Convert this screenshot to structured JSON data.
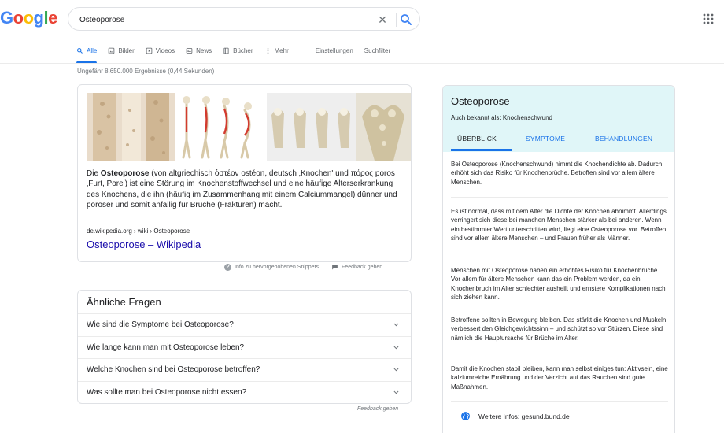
{
  "logo": {
    "letters": [
      "G",
      "o",
      "o",
      "g",
      "l",
      "e"
    ],
    "colors": [
      "#4285F4",
      "#EA4335",
      "#FBBC05",
      "#4285F4",
      "#34A853",
      "#EA4335"
    ]
  },
  "search": {
    "query": "Osteoporose",
    "clear_icon": "close-icon",
    "search_icon": "search-icon"
  },
  "tabs": [
    {
      "label": "Alle",
      "icon": "search-icon",
      "active": true
    },
    {
      "label": "Bilder",
      "icon": "image-icon"
    },
    {
      "label": "Videos",
      "icon": "video-icon"
    },
    {
      "label": "News",
      "icon": "news-icon"
    },
    {
      "label": "Bücher",
      "icon": "book-icon"
    },
    {
      "label": "Mehr",
      "icon": "more-vert-icon"
    }
  ],
  "tools": {
    "settings": "Einstellungen",
    "filter": "Suchfilter"
  },
  "results_count": "Ungefähr 8.650.000 Ergebnisse (0,44 Sekunden)",
  "snippet": {
    "text_bold": "Osteoporose",
    "text_pre": "Die ",
    "text_post": " (von altgriechisch ὀστέον ostéon, deutsch ‚Knochen' und πόρος poros ‚Furt, Pore') ist eine Störung im Knochenstoffwechsel und eine häufige Alterserkrankung des Knochens, die ihn (häufig im Zusammenhang mit einem Calciummangel) dünner und poröser und somit anfällig für Brüche (Frakturen) macht.",
    "url": "de.wikipedia.org › wiki › Osteoporose",
    "title": "Osteoporose – Wikipedia",
    "info": "Info zu hervorgehobenen Snippets",
    "feedback": "Feedback geben"
  },
  "paa": {
    "title": "Ähnliche Fragen",
    "questions": [
      "Wie sind die Symptome bei Osteoporose?",
      "Wie lange kann man mit Osteoporose leben?",
      "Welche Knochen sind bei Osteoporose betroffen?",
      "Was sollte man bei Osteoporose nicht essen?"
    ],
    "feedback": "Feedback geben"
  },
  "kp": {
    "title": "Osteoporose",
    "aka": "Auch bekannt als: Knochenschwund",
    "tabs": [
      "ÜBERBLICK",
      "SYMPTOME",
      "BEHANDLUNGEN"
    ],
    "paragraphs": [
      "Bei Osteoporose (Knochenschwund) nimmt die Knochendichte ab. Dadurch erhöht sich das Risiko für Knochenbrüche. Betroffen sind vor allem ältere Menschen.",
      "Es ist normal, dass mit dem Alter die Dichte der Knochen abnimmt. Allerdings verringert sich diese bei manchen Menschen stärker als bei anderen. Wenn ein bestimmter Wert unterschritten wird, liegt eine Osteoporose vor. Betroffen sind vor allem ältere Menschen – und Frauen früher als Männer.",
      "Menschen mit Osteoporose haben ein erhöhtes Risiko für Knochenbrüche. Vor allem für ältere Menschen kann das ein Problem werden, da ein Knochenbruch im Alter schlechter ausheilt und ernstere Komplikationen nach sich ziehen kann.",
      "Betroffene sollten in Bewegung bleiben. Das stärkt die Knochen und Muskeln, verbessert den Gleichgewichtssinn – und schützt so vor Stürzen. Diese sind nämlich die Hauptursache für Brüche im Alter.",
      "Damit die Knochen stabil bleiben, kann man selbst einiges tun: Aktivsein, eine kalziumreiche Ernährung und der Verzicht auf das Rauchen sind gute Maßnahmen."
    ],
    "more": "Weitere Infos: gesund.bund.de"
  },
  "colors": {
    "link": "#1a0dab",
    "accent": "#1a73e8",
    "kp_header": "#e0f6f8"
  }
}
